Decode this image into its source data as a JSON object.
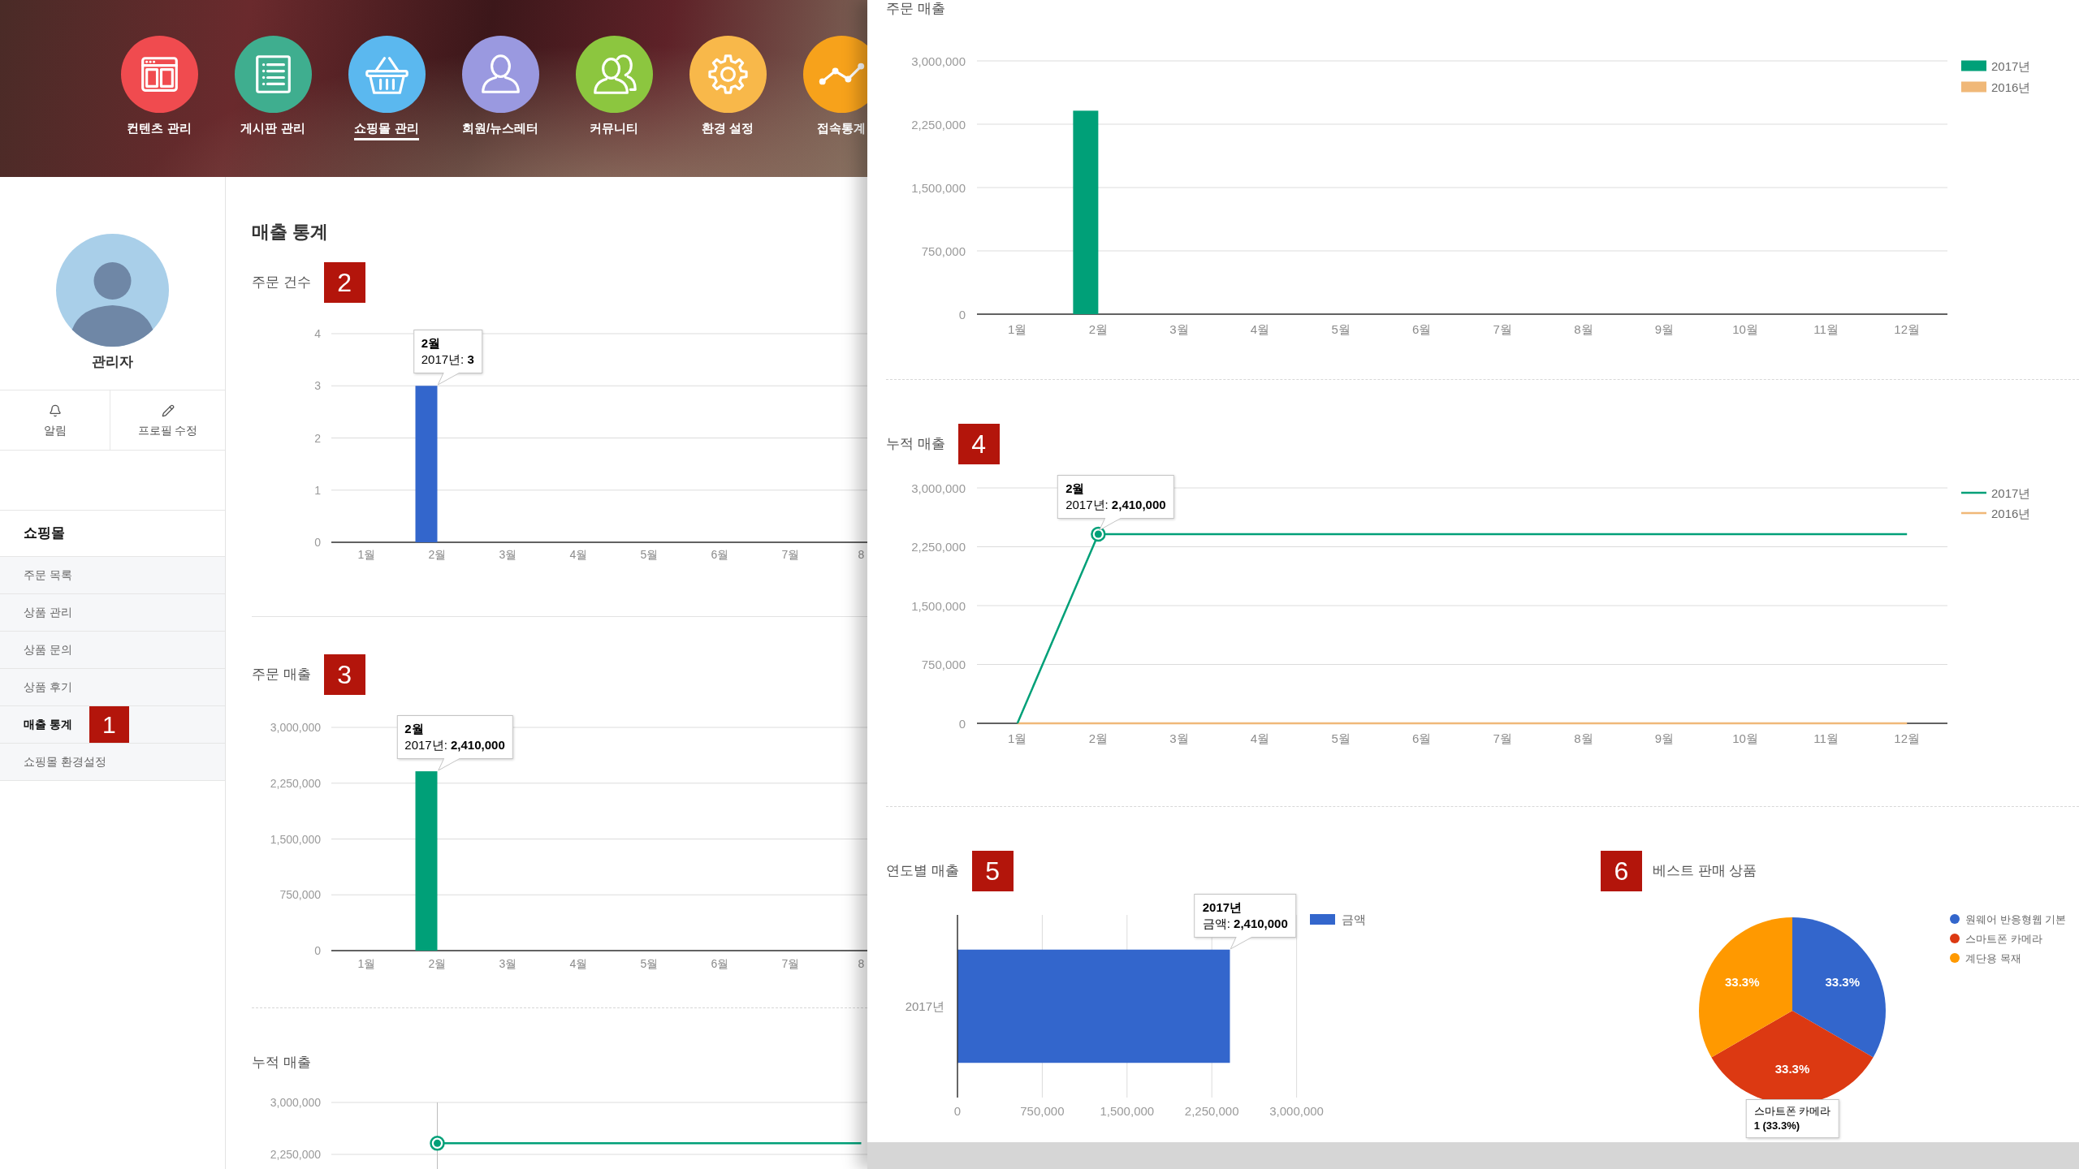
{
  "top_nav": {
    "items": [
      {
        "label": "컨텐츠 관리",
        "color": "#f04b4f",
        "selected": false
      },
      {
        "label": "게시판 관리",
        "color": "#3fae8f",
        "selected": false
      },
      {
        "label": "쇼핑몰 관리",
        "color": "#5bb8ef",
        "selected": true
      },
      {
        "label": "회원/뉴스레터",
        "color": "#9a99e0",
        "selected": false
      },
      {
        "label": "커뮤니티",
        "color": "#8cc63f",
        "selected": false
      },
      {
        "label": "환경 설정",
        "color": "#f8b84a",
        "selected": false
      },
      {
        "label": "접속통계",
        "color": "#f7a21b",
        "selected": false
      }
    ]
  },
  "sidebar": {
    "profile": {
      "name": "관리자"
    },
    "actions": [
      {
        "label": "알림"
      },
      {
        "label": "프로필 수정"
      }
    ],
    "section_title": "쇼핑몰",
    "items": [
      {
        "label": "주문 목록",
        "selected": false
      },
      {
        "label": "상품 관리",
        "selected": false
      },
      {
        "label": "상품 문의",
        "selected": false
      },
      {
        "label": "상품 후기",
        "selected": false
      },
      {
        "label": "매출 통계",
        "selected": true,
        "marker": "1"
      },
      {
        "label": "쇼핑몰 환경설정",
        "selected": false
      }
    ]
  },
  "main": {
    "title": "매출 통계",
    "sections": [
      {
        "header": [
          {
            "kind": "title",
            "text": "주문 건수"
          },
          {
            "kind": "marker",
            "text": "2"
          }
        ],
        "chart_data": {
          "type": "bar",
          "categories": [
            "1월",
            "2월",
            "3월",
            "4월",
            "5월",
            "6월",
            "7월",
            "8"
          ],
          "series": [
            {
              "color": "#3366cc",
              "values": [
                0,
                3,
                0,
                0,
                0,
                0,
                0,
                0
              ]
            }
          ],
          "ylim": [
            0,
            4
          ],
          "yticks": [
            {
              "value": 0,
              "label": "0"
            },
            {
              "value": 1,
              "label": "1"
            },
            {
              "value": 2,
              "label": "2"
            },
            {
              "value": 3,
              "label": "3"
            },
            {
              "value": 4,
              "label": "4"
            }
          ],
          "grid": true,
          "annotations": [
            "**2월**\n2017년: **3**"
          ]
        }
      },
      {
        "header": [
          {
            "kind": "title",
            "text": "주문 매출"
          },
          {
            "kind": "marker",
            "text": "3"
          }
        ],
        "chart_data": {
          "type": "bar",
          "categories": [
            "1월",
            "2월",
            "3월",
            "4월",
            "5월",
            "6월",
            "7월",
            "8"
          ],
          "series": [
            {
              "color": "#00a078",
              "values": [
                0,
                2410000,
                0,
                0,
                0,
                0,
                0,
                0
              ]
            }
          ],
          "ylim": [
            0,
            3000000
          ],
          "yticks": [
            {
              "value": 0,
              "label": "0"
            },
            {
              "value": 750000,
              "label": "750,000"
            },
            {
              "value": 1500000,
              "label": "1,500,000"
            },
            {
              "value": 2250000,
              "label": "2,250,000"
            },
            {
              "value": 3000000,
              "label": "3,000,000"
            }
          ],
          "grid": true,
          "annotations": [
            "**2월**\n2017년: **2,410,000**"
          ]
        }
      },
      {
        "header": [
          {
            "kind": "title",
            "text": "누적 매출"
          }
        ],
        "chart_data": {
          "type": "line",
          "series": [
            {
              "color": "#00a078",
              "values": [
                null,
                2410000,
                2410000,
                2410000,
                2410000,
                2410000,
                2410000,
                2410000
              ]
            },
            {
              "color": "#00a078",
              "marker": "o",
              "values": [
                null,
                2410000,
                null,
                null,
                null,
                null,
                null,
                null
              ]
            }
          ],
          "ylim": [
            2250000,
            3000000
          ],
          "yticks": [
            {
              "value": 2250000,
              "label": "2,250,000"
            },
            {
              "value": 3000000,
              "label": "3,000,000"
            }
          ]
        }
      }
    ]
  },
  "right_panel": {
    "sections": [
      {
        "header": [
          {
            "kind": "title",
            "text": "주문 매출"
          }
        ],
        "chart_data": {
          "type": "bar",
          "categories": [
            "1월",
            "2월",
            "3월",
            "4월",
            "5월",
            "6월",
            "7월",
            "8월",
            "9월",
            "10월",
            "11월",
            "12월"
          ],
          "series": [
            {
              "name": "2017년",
              "color": "#00a078",
              "values": [
                0,
                2410000,
                0,
                0,
                0,
                0,
                0,
                0,
                0,
                0,
                0,
                0
              ]
            },
            {
              "name": "2016년",
              "color": "#f0b878",
              "values": [
                0,
                0,
                0,
                0,
                0,
                0,
                0,
                0,
                0,
                0,
                0,
                0
              ]
            }
          ],
          "ylim": [
            0,
            3000000
          ],
          "yticks": [
            {
              "value": 0,
              "label": "0"
            },
            {
              "value": 750000,
              "label": "750,000"
            },
            {
              "value": 1500000,
              "label": "1,500,000"
            },
            {
              "value": 2250000,
              "label": "2,250,000"
            },
            {
              "value": 3000000,
              "label": "3,000,000"
            }
          ],
          "grid": true,
          "legend": "right"
        }
      },
      {
        "header": [
          {
            "kind": "title",
            "text": "누적 매출"
          },
          {
            "kind": "marker",
            "text": "4"
          }
        ],
        "chart_data": {
          "type": "line",
          "categories": [
            "1월",
            "2월",
            "3월",
            "4월",
            "5월",
            "6월",
            "7월",
            "8월",
            "9월",
            "10월",
            "11월",
            "12월"
          ],
          "series": [
            {
              "name": "2017년",
              "color": "#00a078",
              "values": [
                0,
                2410000,
                2410000,
                2410000,
                2410000,
                2410000,
                2410000,
                2410000,
                2410000,
                2410000,
                2410000,
                2410000
              ]
            },
            {
              "name": "2016년",
              "color": "#f0b878",
              "values": [
                0,
                0,
                0,
                0,
                0,
                0,
                0,
                0,
                0,
                0,
                0,
                0
              ]
            },
            {
              "color": "#00a078",
              "marker": "o",
              "values": [
                null,
                2410000,
                null,
                null,
                null,
                null,
                null,
                null,
                null,
                null,
                null,
                null
              ]
            }
          ],
          "ylim": [
            0,
            3000000
          ],
          "yticks": [
            {
              "value": 0,
              "label": "0"
            },
            {
              "value": 750000,
              "label": "750,000"
            },
            {
              "value": 1500000,
              "label": "1,500,000"
            },
            {
              "value": 2250000,
              "label": "2,250,000"
            },
            {
              "value": 3000000,
              "label": "3,000,000"
            }
          ],
          "grid": true,
          "legend": "right",
          "annotations": [
            "**2월**\n2017년: **2,410,000**"
          ]
        }
      }
    ],
    "bottom_row": [
      {
        "header": [
          {
            "kind": "title",
            "text": "연도별 매출"
          },
          {
            "kind": "marker",
            "text": "5"
          }
        ],
        "chart_data": {
          "type": "bar",
          "orientation": "horizontal",
          "categories": [
            "2017년"
          ],
          "series": [
            {
              "name": "금액",
              "color": "#3366cc",
              "values": [
                2410000
              ]
            }
          ],
          "xlim": [
            0,
            3000000
          ],
          "xticks": [
            {
              "value": 0,
              "label": "0"
            },
            {
              "value": 750000,
              "label": "750,000"
            },
            {
              "value": 1500000,
              "label": "1,500,000"
            },
            {
              "value": 2250000,
              "label": "2,250,000"
            },
            {
              "value": 3000000,
              "label": "3,000,000"
            }
          ],
          "grid": true,
          "legend": "right",
          "annotations": [
            "**2017년**\n금액: **2,410,000**"
          ]
        }
      },
      {
        "header": [
          {
            "kind": "marker",
            "text": "6"
          },
          {
            "kind": "title",
            "text": "베스트 판매 상품"
          }
        ],
        "chart_data": {
          "type": "pie",
          "categories": [
            "원웨어 반응형웹 기본",
            "스마트폰 카메라",
            "계단용 목재"
          ],
          "values": [
            33.3,
            33.3,
            33.3
          ],
          "colors": [
            "#3366cc",
            "#dc3912",
            "#ff9900"
          ],
          "value_labels": [
            "33.3%",
            "33.3%",
            "33.3%"
          ],
          "legend": "right",
          "annotations": [
            "스마트폰 카메라\n**1 (33.3%)**"
          ]
        }
      }
    ]
  }
}
